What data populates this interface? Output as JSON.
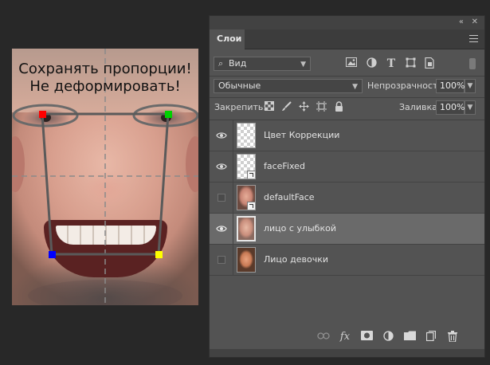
{
  "canvas": {
    "caption_line1": "Сохранять пропорции!",
    "caption_line2": "Не деформировать!",
    "marker_colors": [
      "#ff0000",
      "#00d000",
      "#0000ff",
      "#ffff00"
    ]
  },
  "panel": {
    "top_controls": {
      "collapse": "«",
      "close": "✕"
    },
    "tab_label": "Слои",
    "filter": {
      "kind_label": "Вид",
      "search_glyph": "⌕"
    },
    "blend": {
      "mode": "Обычные",
      "opacity_label": "Непрозрачность:",
      "opacity_value": "100%"
    },
    "lock": {
      "label": "Закрепить:",
      "fill_label": "Заливка:",
      "fill_value": "100%"
    },
    "layers": [
      {
        "name": "Цвет Коррекции",
        "visible": true,
        "thumb": "transparent",
        "smart": false,
        "selected": false
      },
      {
        "name": "faceFixed",
        "visible": true,
        "thumb": "transparent",
        "smart": true,
        "selected": false
      },
      {
        "name": "defaultFace",
        "visible": false,
        "thumb": "face",
        "smart": true,
        "selected": false
      },
      {
        "name": "лицо с улыбкой",
        "visible": true,
        "thumb": "face2",
        "smart": false,
        "selected": true
      },
      {
        "name": "Лицо девочки",
        "visible": false,
        "thumb": "girl",
        "smart": false,
        "selected": false
      }
    ],
    "bottom_buttons": [
      "link-icon",
      "fx-icon",
      "mask-icon",
      "adjustment-icon",
      "folder-icon",
      "new-layer-icon",
      "trash-icon"
    ],
    "fx_label": "fx"
  },
  "colors": {
    "panel_bg": "#535353",
    "selected_row": "#6a6a6a",
    "app_bg": "#282828"
  }
}
